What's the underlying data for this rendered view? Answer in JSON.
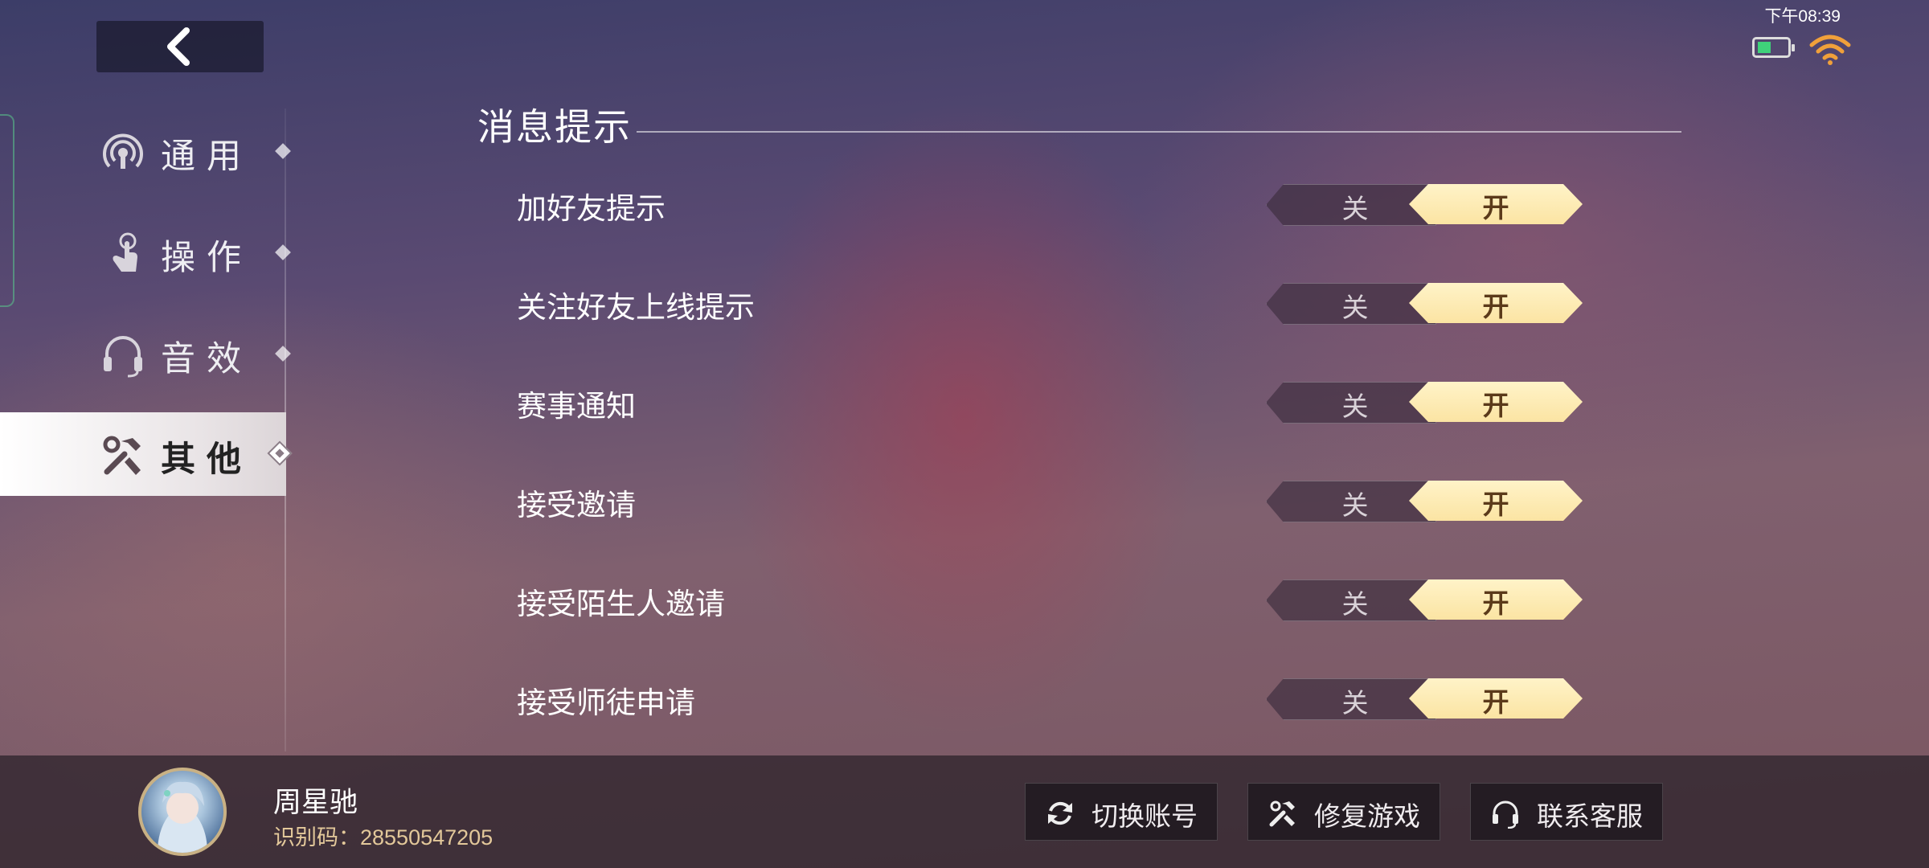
{
  "status": {
    "time": "下午08:39"
  },
  "sidebar": {
    "items": [
      {
        "label": "通用",
        "icon": "broadcast-icon",
        "active": false
      },
      {
        "label": "操作",
        "icon": "tap-hand-icon",
        "active": false
      },
      {
        "label": "音效",
        "icon": "headset-icon",
        "active": false
      },
      {
        "label": "其他",
        "icon": "tools-icon",
        "active": true
      }
    ]
  },
  "section": {
    "title": "消息提示",
    "rows": [
      {
        "label": "加好友提示",
        "off": "关",
        "on": "开",
        "value": "on"
      },
      {
        "label": "关注好友上线提示",
        "off": "关",
        "on": "开",
        "value": "on"
      },
      {
        "label": "赛事通知",
        "off": "关",
        "on": "开",
        "value": "on"
      },
      {
        "label": "接受邀请",
        "off": "关",
        "on": "开",
        "value": "on"
      },
      {
        "label": "接受陌生人邀请",
        "off": "关",
        "on": "开",
        "value": "on"
      },
      {
        "label": "接受师徒申请",
        "off": "关",
        "on": "开",
        "value": "on"
      }
    ]
  },
  "footer": {
    "user_name": "周星驰",
    "user_id": "识别码：28550547205",
    "buttons": [
      {
        "label": "切换账号",
        "icon": "refresh-icon"
      },
      {
        "label": "修复游戏",
        "icon": "tools-icon"
      },
      {
        "label": "联系客服",
        "icon": "headset-icon"
      }
    ]
  },
  "colors": {
    "toggle_on": "#fbe4a3",
    "accent_text": "#e3c89a"
  }
}
